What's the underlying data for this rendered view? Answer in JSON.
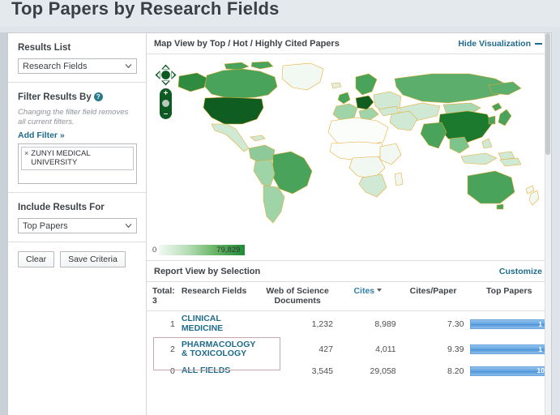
{
  "page": {
    "title": "Top Papers by Research Fields",
    "background_color": "#dfe4ea"
  },
  "sidebar": {
    "results_list": {
      "label": "Results List",
      "selected": "Research Fields",
      "options": [
        "Research Fields"
      ]
    },
    "filter_results_by": {
      "label": "Filter Results By",
      "help_icon": "question-mark-icon",
      "note": "Changing the filter field removes all current filters.",
      "add_filter_label": "Add Filter »",
      "chips": [
        {
          "remove_icon": "close-icon",
          "label": "ZUNYI MEDICAL UNIVERSITY"
        }
      ]
    },
    "include_results_for": {
      "label": "Include Results For",
      "selected": "Top Papers",
      "options": [
        "Top Papers"
      ]
    },
    "buttons": {
      "clear": "Clear",
      "save_criteria": "Save Criteria"
    }
  },
  "map_panel": {
    "title_prefix": "Map View by",
    "title_value": "Top / Hot / Highly Cited Papers",
    "hide_label": "Hide Visualization",
    "hide_icon": "minus-icon",
    "nav": {
      "pan_icon": "pan-arrows-icon",
      "zoom_in": "+",
      "zoom_out": "–",
      "globe_icon": "globe-icon"
    },
    "legend": {
      "min": "0",
      "max": "79,829",
      "ramp_colors": [
        "#f2f9f2",
        "#b7ddb7",
        "#63b363",
        "#1f8a36"
      ]
    }
  },
  "report_panel": {
    "title": "Report View by Selection",
    "customize_label": "Customize",
    "total_label": "Total:",
    "total_value": "3",
    "columns": [
      "Research Fields",
      "Web of Science Documents",
      "Cites",
      "Cites/Paper",
      "Top Papers"
    ],
    "sorted_column": "Cites",
    "sort_direction": "descending",
    "rows": [
      {
        "rank": "1",
        "field": "CLINICAL MEDICINE",
        "wos_documents": "1,232",
        "cites": "8,989",
        "cites_per_paper": "7.30",
        "top_papers": "1",
        "bar_fraction": 0.97
      },
      {
        "rank": "2",
        "field": "PHARMACOLOGY & TOXICOLOGY",
        "wos_documents": "427",
        "cites": "4,011",
        "cites_per_paper": "9.39",
        "top_papers": "1",
        "bar_fraction": 0.97,
        "highlighted": true
      },
      {
        "rank": "0",
        "field": "ALL FIELDS",
        "wos_documents": "3,545",
        "cites": "29,058",
        "cites_per_paper": "8.20",
        "top_papers": "10",
        "bar_fraction": 1.0
      }
    ]
  },
  "chart_data": {
    "type": "map",
    "title": "Map View by Top / Hot / Highly Cited Papers",
    "color_scale_min": 0,
    "color_scale_max": 79829,
    "legend_min_label": "0",
    "legend_max_label": "79,829",
    "ramp_colors": [
      "#f2f9f2",
      "#b7ddb7",
      "#63b363",
      "#1f8a36"
    ],
    "highlighted_regions": [
      {
        "name": "United States",
        "intensity": "very-high"
      },
      {
        "name": "China",
        "intensity": "very-high"
      },
      {
        "name": "Germany",
        "intensity": "very-high"
      },
      {
        "name": "Canada",
        "intensity": "high"
      },
      {
        "name": "Russia",
        "intensity": "high"
      },
      {
        "name": "Brazil",
        "intensity": "high"
      },
      {
        "name": "Australia",
        "intensity": "high"
      },
      {
        "name": "India",
        "intensity": "high"
      },
      {
        "name": "United Kingdom",
        "intensity": "high"
      },
      {
        "name": "France",
        "intensity": "high"
      },
      {
        "name": "Africa",
        "intensity": "low"
      }
    ]
  }
}
